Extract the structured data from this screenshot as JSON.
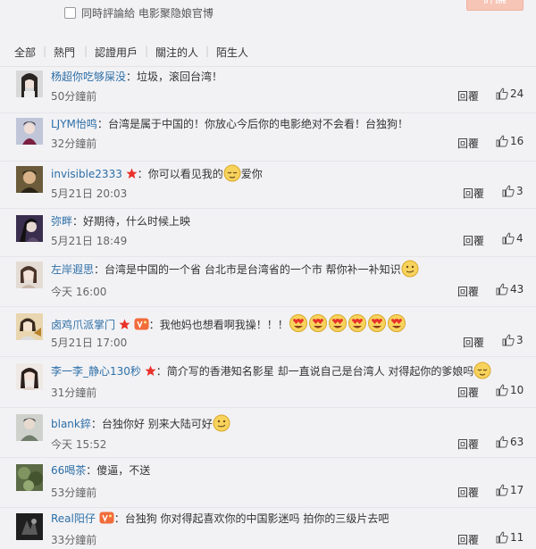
{
  "composer": {
    "also_comment_label": "同時評論給 电影聚隐娘官博",
    "submit_label": "評論"
  },
  "filters": {
    "all": "全部",
    "hot": "熱門",
    "verified": "認證用戶",
    "following": "關注的人",
    "strangers": "陌生人"
  },
  "actions": {
    "reply_label": "回覆"
  },
  "comments": [
    {
      "user": "杨超你吃够屎没",
      "sep": "：",
      "text": "垃圾，滚回台湾！",
      "time": "50分鐘前",
      "likes": "24"
    },
    {
      "user": "LJYM怡鸣",
      "sep": "：",
      "text": "台湾是属于中国的！你放心今后你的电影绝对不会看！台独狗！",
      "time": "32分鐘前",
      "likes": "16"
    },
    {
      "user": "invisible2333",
      "sep": "：",
      "text": "你可以看见我的",
      "text2": "爱你",
      "time": "5月21日 20:03",
      "likes": "3"
    },
    {
      "user": "弥畔",
      "sep": "：",
      "text": "好期待，什么时候上映",
      "time": "5月21日 18:49",
      "likes": "4"
    },
    {
      "user": "左岸遐思",
      "sep": "：",
      "text": "台湾是中国的一个省 台北市是台湾省的一个市 帮你补一补知识",
      "time": "今天 16:00",
      "likes": "43"
    },
    {
      "user": "卤鸡爪派掌门",
      "sep": "：",
      "text": "我他妈也想看啊我操！！！",
      "time": "5月21日 17:00",
      "likes": "3"
    },
    {
      "user": "李一李_静心130秒",
      "sep": "：",
      "text": "简介写的香港知名影星 却一直说自己是台湾人 对得起你的爹娘吗",
      "time": "31分鐘前",
      "likes": "10"
    },
    {
      "user": "blank錊",
      "sep": "：",
      "text": "台独你好 别来大陆可好",
      "time": "今天 15:52",
      "likes": "63"
    },
    {
      "user": "66喝茶",
      "sep": "：",
      "text": "傻逼，不送",
      "time": "53分鐘前",
      "likes": "17"
    },
    {
      "user": "Real阳仔",
      "sep": "：",
      "text": "台独狗 你对得起喜欢你的中国影迷吗 拍你的三级片去吧",
      "time": "33分鐘前",
      "likes": "11"
    }
  ]
}
